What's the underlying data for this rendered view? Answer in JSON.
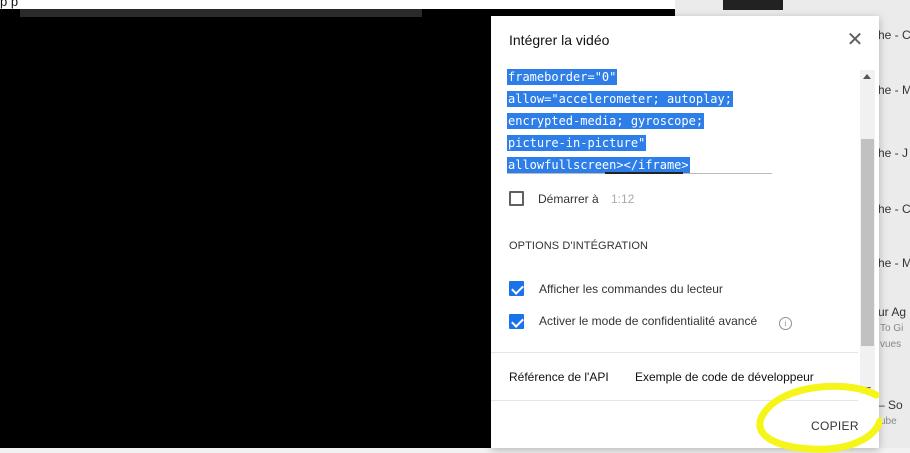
{
  "page": {
    "top_fragment": "p         p"
  },
  "side_list": [
    {
      "text": "he - C"
    },
    {
      "text": "he - M"
    },
    {
      "text": "he - J"
    },
    {
      "text": "he - C"
    },
    {
      "text": "he - M"
    },
    {
      "text": "ur Ag"
    },
    {
      "text": "To Gi",
      "sub": true
    },
    {
      "text": "vues",
      "sub": true
    },
    {
      "text": "– So"
    },
    {
      "text": "ube",
      "sub": true
    }
  ],
  "dialog": {
    "title": "Intégrer la vidéo",
    "close_icon": "close-icon",
    "code_lines": [
      "frameborder=\"0\"",
      "allow=\"accelerometer; autoplay;",
      "encrypted-media; gyroscope;",
      "picture-in-picture\"",
      "allowfullscreen></iframe>"
    ],
    "start_label": "Démarrer à",
    "start_time": "1:12",
    "start_checked": false,
    "options_heading": "OPTIONS D'INTÉGRATION",
    "options": [
      {
        "label": "Afficher les commandes du lecteur",
        "checked": true
      },
      {
        "label": "Activer le mode de confidentialité avancé",
        "checked": true,
        "info_icon": "info-icon"
      }
    ],
    "links": {
      "api_reference": "Référence de l'API",
      "developer_sample": "Exemple de code de développeur"
    },
    "copy_button": "COPIER"
  },
  "colors": {
    "selection": "#2d7ee8",
    "checkbox_blue": "#1a73e8",
    "highlight": "#f5f51a"
  }
}
